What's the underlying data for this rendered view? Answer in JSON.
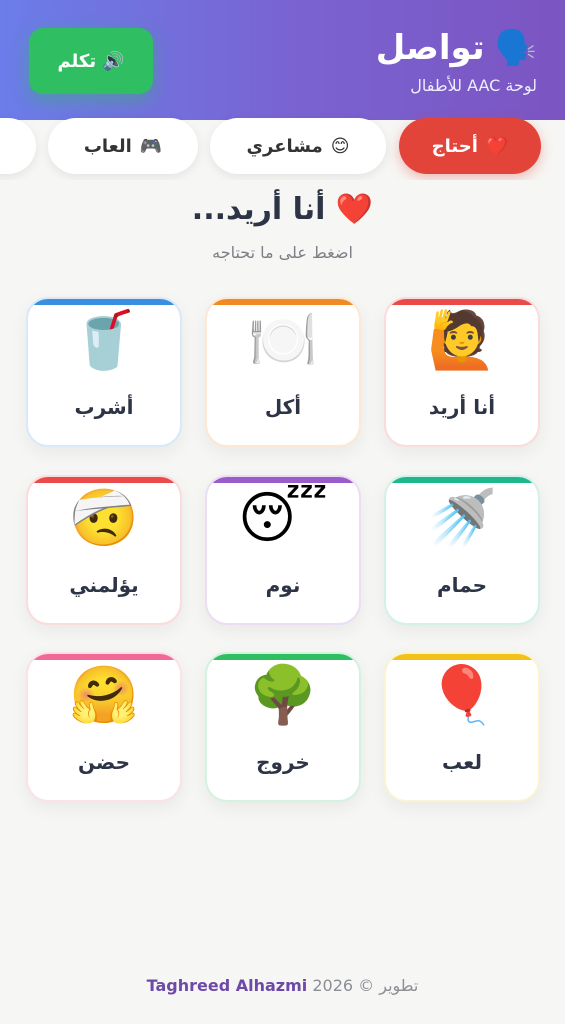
{
  "header": {
    "title": "تواصل",
    "title_icon": "🗣️",
    "subtitle": "لوحة AAC للأطفال",
    "speak_label": "تكلم",
    "speak_icon": "🔊"
  },
  "tabs": [
    {
      "label": "أحتاج",
      "icon": "❤️",
      "active": true
    },
    {
      "label": "مشاعري",
      "icon": "😊",
      "active": false
    },
    {
      "label": "العاب",
      "icon": "🎮",
      "active": false
    }
  ],
  "section": {
    "title": "أنا أريد...",
    "title_icon": "❤️",
    "subtitle": "اضغط على ما تحتاجه"
  },
  "cards": [
    {
      "label": "أنا أريد",
      "icon": "🙋",
      "accent": "#e94a4a"
    },
    {
      "label": "أكل",
      "icon": "🍽️",
      "accent": "#f08a24"
    },
    {
      "label": "أشرب",
      "icon": "🥤",
      "accent": "#3b8fe0"
    },
    {
      "label": "حمام",
      "icon": "🚿",
      "accent": "#1fb88a"
    },
    {
      "label": "نوم",
      "icon": "😴",
      "accent": "#9b5cc9"
    },
    {
      "label": "يؤلمني",
      "icon": "🤕",
      "accent": "#e94a4a"
    },
    {
      "label": "لعب",
      "icon": "🎈",
      "accent": "#f2c21a"
    },
    {
      "label": "خروج",
      "icon": "🌳",
      "accent": "#2fbf62"
    },
    {
      "label": "حضن",
      "icon": "🤗",
      "accent": "#f06a95"
    }
  ],
  "footer": {
    "prefix": "تطوير © 2026",
    "name": "Taghreed Alhazmi"
  }
}
